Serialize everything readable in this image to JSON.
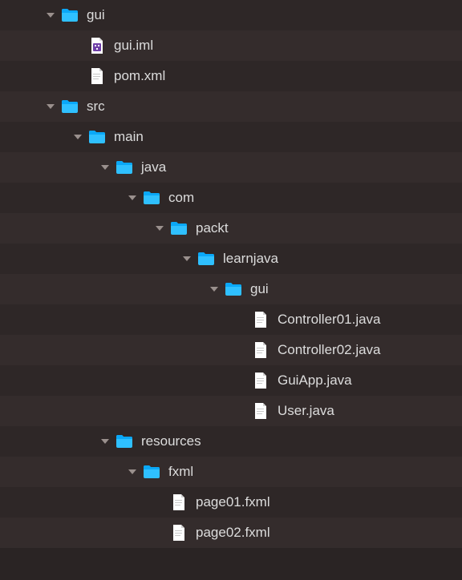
{
  "colors": {
    "chevron": "#9a908d",
    "text": "#dcdcdc",
    "folder_fill": "#2fc0ff",
    "folder_top": "#0aa8f8",
    "file_fill": "#ffffff",
    "file_fold": "#d0d0d0",
    "iml_fill": "#6f3fa8",
    "iml_glyph": "#ffffff"
  },
  "tree": [
    {
      "depth": 0,
      "expanded": true,
      "kind": "folder",
      "label": "gui",
      "name": "folder-gui"
    },
    {
      "depth": 1,
      "expanded": null,
      "kind": "iml",
      "label": "gui.iml",
      "name": "file-gui-iml"
    },
    {
      "depth": 1,
      "expanded": null,
      "kind": "file",
      "label": "pom.xml",
      "name": "file-pom-xml"
    },
    {
      "depth": 0,
      "expanded": true,
      "kind": "folder",
      "label": "src",
      "name": "folder-src"
    },
    {
      "depth": 1,
      "expanded": true,
      "kind": "folder",
      "label": "main",
      "name": "folder-main"
    },
    {
      "depth": 2,
      "expanded": true,
      "kind": "folder",
      "label": "java",
      "name": "folder-java"
    },
    {
      "depth": 3,
      "expanded": true,
      "kind": "folder",
      "label": "com",
      "name": "folder-com"
    },
    {
      "depth": 4,
      "expanded": true,
      "kind": "folder",
      "label": "packt",
      "name": "folder-packt"
    },
    {
      "depth": 5,
      "expanded": true,
      "kind": "folder",
      "label": "learnjava",
      "name": "folder-learnjava"
    },
    {
      "depth": 6,
      "expanded": true,
      "kind": "folder",
      "label": "gui",
      "name": "folder-gui-pkg"
    },
    {
      "depth": 7,
      "expanded": null,
      "kind": "file",
      "label": "Controller01.java",
      "name": "file-controller01-java"
    },
    {
      "depth": 7,
      "expanded": null,
      "kind": "file",
      "label": "Controller02.java",
      "name": "file-controller02-java"
    },
    {
      "depth": 7,
      "expanded": null,
      "kind": "file",
      "label": "GuiApp.java",
      "name": "file-guiapp-java"
    },
    {
      "depth": 7,
      "expanded": null,
      "kind": "file",
      "label": "User.java",
      "name": "file-user-java"
    },
    {
      "depth": 2,
      "expanded": true,
      "kind": "folder",
      "label": "resources",
      "name": "folder-resources"
    },
    {
      "depth": 3,
      "expanded": true,
      "kind": "folder",
      "label": "fxml",
      "name": "folder-fxml"
    },
    {
      "depth": 4,
      "expanded": null,
      "kind": "file",
      "label": "page01.fxml",
      "name": "file-page01-fxml"
    },
    {
      "depth": 4,
      "expanded": null,
      "kind": "file",
      "label": "page02.fxml",
      "name": "file-page02-fxml"
    }
  ],
  "layout": {
    "base_indent": 48,
    "step_indent": 34
  }
}
